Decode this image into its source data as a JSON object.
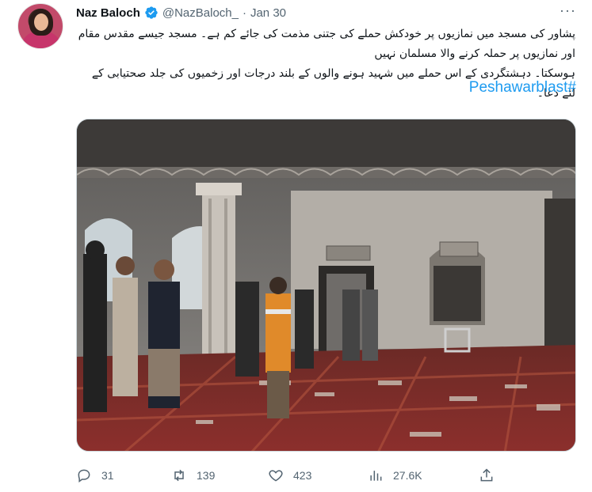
{
  "author": {
    "name": "Naz Baloch",
    "handle": "@NazBaloch_",
    "separator": "·",
    "date": "Jan 30"
  },
  "tweet": {
    "text_line1": "پشاور کی مسجد میں نمازیوں پر خودکش حملے کی جتنی مذمت کی جائے کم ہے۔ مسجد جیسے مقدس مقام اور نمازیوں پر حملہ کرنے والا مسلمان نہیں",
    "text_line2": "ہوسکتا۔ دہشتگردی کے اس حملے میں شہید ہونے والوں کے بلند درجات اور زخمیوں کی جلد صحتیابی کے لئے دعا۔",
    "hashtag": "Peshawarblast#"
  },
  "metrics": {
    "replies": "31",
    "retweets": "139",
    "likes": "423",
    "views": "27.6K"
  },
  "icons": {
    "more": "more-icon",
    "verified": "verified-badge-icon",
    "reply": "reply-icon",
    "retweet": "retweet-icon",
    "like": "heart-icon",
    "views": "views-chart-icon",
    "share": "share-icon"
  },
  "colors": {
    "link": "#1d9bf0",
    "verified": "#1d9bf0",
    "secondary_text": "#536471"
  }
}
